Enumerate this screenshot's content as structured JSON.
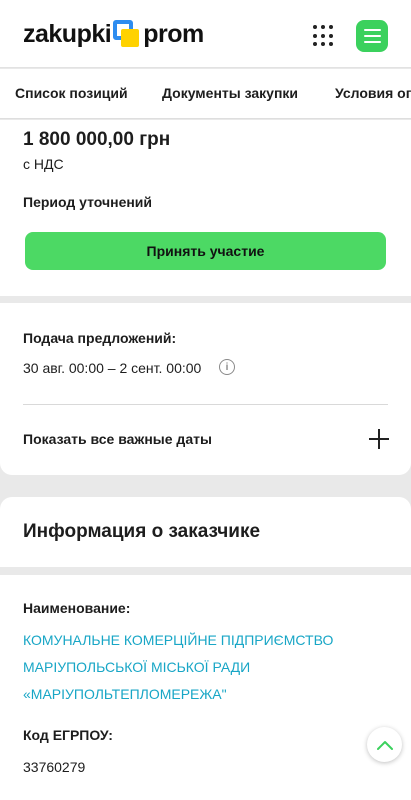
{
  "header": {
    "logo_left": "zakupki",
    "logo_right": "prom",
    "apps_icon": "grid-apps-icon",
    "menu_icon": "hamburger-menu-icon",
    "brand_green": "#3bd15d"
  },
  "tabs": [
    "Список позиций",
    "Документы закупки",
    "Условия оп"
  ],
  "price": {
    "amount": "1 800 000,00 грн",
    "vat": "с НДС",
    "period": "Период уточнений",
    "join_label": "Принять участие"
  },
  "dates": {
    "submission_label": "Подача предложений:",
    "submission_range": "30 авг. 00:00 – 2 сент. 00:00",
    "show_all_label": "Показать все важные даты"
  },
  "customer": {
    "section_title": "Информация о заказчике",
    "name_label": "Наименование:",
    "name_lines": [
      "КОМУНАЛЬНЕ КОМЕРЦІЙНЕ ПІДПРИЄМСТВО",
      "МАРІУПОЛЬСЬКОЇ МІСЬКОЇ РАДИ",
      "«МАРІУПОЛЬТЕПЛОМЕРЕЖА\""
    ],
    "code_label": "Код ЕГРПОУ:",
    "code_value": "33760279",
    "link_color": "#18a6c6"
  }
}
